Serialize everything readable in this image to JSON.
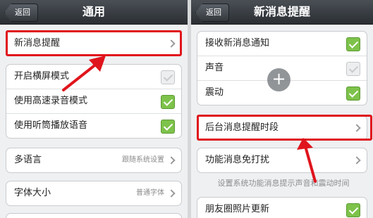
{
  "left": {
    "nav": {
      "back": "返回",
      "title": "通用"
    },
    "items": [
      {
        "label": "新消息提醒"
      },
      {
        "label": "开启横屏模式",
        "checked": false
      },
      {
        "label": "使用高速录音模式",
        "checked": true
      },
      {
        "label": "使用听筒播放语音",
        "checked": true
      },
      {
        "label": "多语言",
        "value": "跟随系统设置"
      },
      {
        "label": "字体大小",
        "value": "普通字体"
      }
    ]
  },
  "right": {
    "nav": {
      "back": "返回",
      "title": "新消息提醒"
    },
    "items": [
      {
        "label": "接收新消息通知",
        "checked": true
      },
      {
        "label": "声音",
        "checked": false
      },
      {
        "label": "震动",
        "checked": true
      },
      {
        "label": "后台消息提醒时段"
      },
      {
        "label": "功能消息免打扰"
      },
      {
        "label": "朋友圈照片更新",
        "checked": true
      }
    ],
    "hint": "设置系统功能消息提示声音和震动时间"
  },
  "icons": {
    "plus": "+"
  },
  "colors": {
    "checked": "#7dc24a",
    "highlight": "#e0141c",
    "navbar": "#34383d"
  }
}
